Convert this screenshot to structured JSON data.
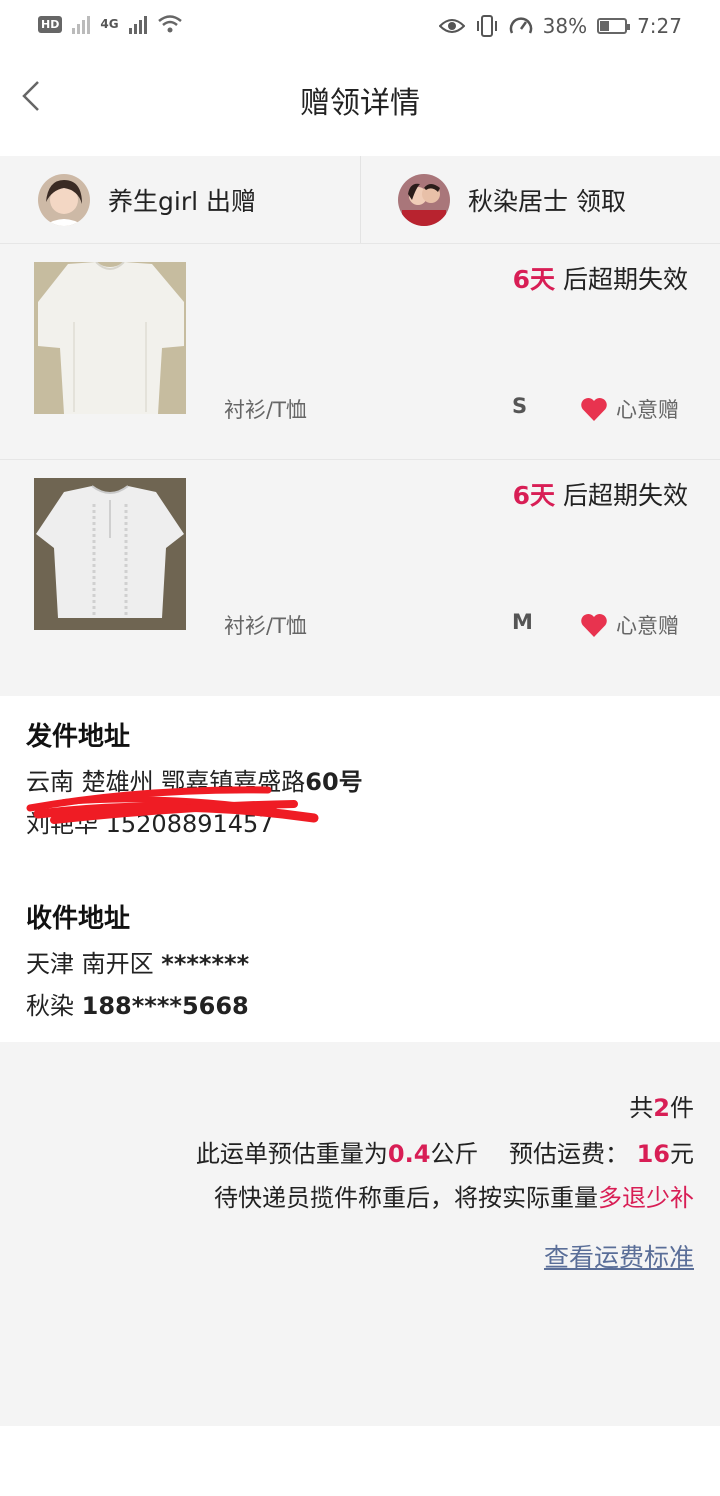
{
  "status_bar": {
    "network": "4G",
    "battery": "38%",
    "battery_level": 0.38,
    "time": "7:27"
  },
  "header": {
    "title": "赠领详情",
    "back_icon": "chevron-left-icon"
  },
  "parties": {
    "giver": {
      "name": "养生girl",
      "action": "出赠"
    },
    "receiver": {
      "name": "秋染居士",
      "action": "领取"
    }
  },
  "items": [
    {
      "expire_days": "6天",
      "expire_text": "后超期失效",
      "category": "衬衫/T恤",
      "size": "S",
      "gift_label": "心意赠"
    },
    {
      "expire_days": "6天",
      "expire_text": "后超期失效",
      "category": "衬衫/T恤",
      "size": "M",
      "gift_label": "心意赠"
    }
  ],
  "sender_address": {
    "label": "发件地址",
    "region": "云南 楚雄州 鄂嘉镇嘉盛路",
    "number": "60号",
    "contact": "刘艳华 15208891457"
  },
  "receiver_address": {
    "label": "收件地址",
    "region": "天津 南开区",
    "detail": "*******",
    "name": "秋染",
    "phone": "188****5668"
  },
  "summary": {
    "count_prefix": "共",
    "count": "2",
    "count_suffix": "件",
    "weight_prefix": "此运单预估重量为",
    "weight": "0.4",
    "weight_unit": "公斤",
    "fee_prefix": "预估运费：",
    "fee": "16",
    "fee_unit": "元",
    "note_prefix": "待快递员揽件称重后，将按实际重量",
    "note_highlight": "多退少补",
    "link": "查看运费标准"
  },
  "colors": {
    "accent": "#d81e55",
    "link": "#5a6e98",
    "panel_bg": "#f4f4f4"
  }
}
